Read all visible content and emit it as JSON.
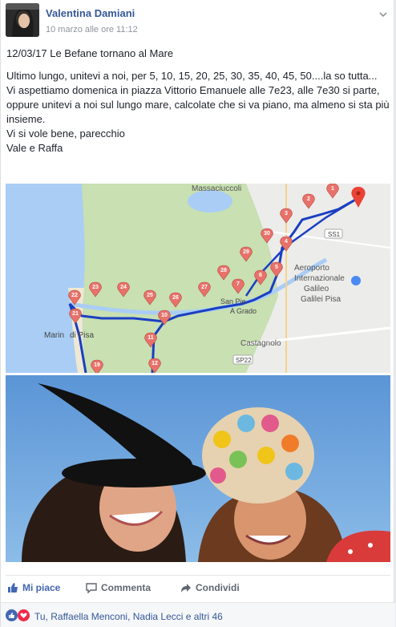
{
  "post": {
    "author": "Valentina Damiani",
    "timestamp": "10 marzo alle ore 11:12",
    "lines": [
      "12/03/17 Le Befane tornano al Mare",
      "Ultimo lungo, unitevi a noi, per 5, 10, 15, 20, 25, 30, 35, 40, 45, 50....la so tutta...",
      "Vi aspettiamo domenica in piazza Vittorio Emanuele alle 7e23, alle 7e30 si parte, oppure unitevi a noi sul lungo mare, calcolate che si va piano, ma almeno si sta più insieme.",
      "Vi si vole bene, parecchio",
      "Vale e Raffa"
    ]
  },
  "map": {
    "labels": {
      "massaciuccoli": "Massaciuccoli",
      "aeroporto": "Aeroporto Internazionale Galileo Galilei Pisa",
      "aeroporto_l1": "Aeroporto",
      "aeroporto_l2": "Internazionale",
      "aeroporto_l3": "Galileo",
      "aeroporto_l4": "Galilei Pisa",
      "marina_l1": "Marin",
      "marina_l2": "di Pisa",
      "san_piero_l1": "San Pie",
      "san_piero_l2": "A Grado",
      "castagnolo": "Castagnolo",
      "ss1": "SS1",
      "sp22": "SP22"
    },
    "pins": [
      "1",
      "2",
      "3",
      "4",
      "5",
      "6",
      "7",
      "10",
      "11",
      "12",
      "19",
      "21",
      "22",
      "23",
      "24",
      "25",
      "26",
      "27",
      "28",
      "29",
      "30"
    ]
  },
  "actions": {
    "like": "Mi piace",
    "comment": "Commenta",
    "share": "Condividi"
  },
  "reactions": {
    "text": "Tu, Raffaella Menconi, Nadia Lecci e altri 46"
  },
  "colors": {
    "link": "#365899",
    "like_active": "#4267b2",
    "route": "#1a3fc2",
    "pin": "#e8726a"
  }
}
